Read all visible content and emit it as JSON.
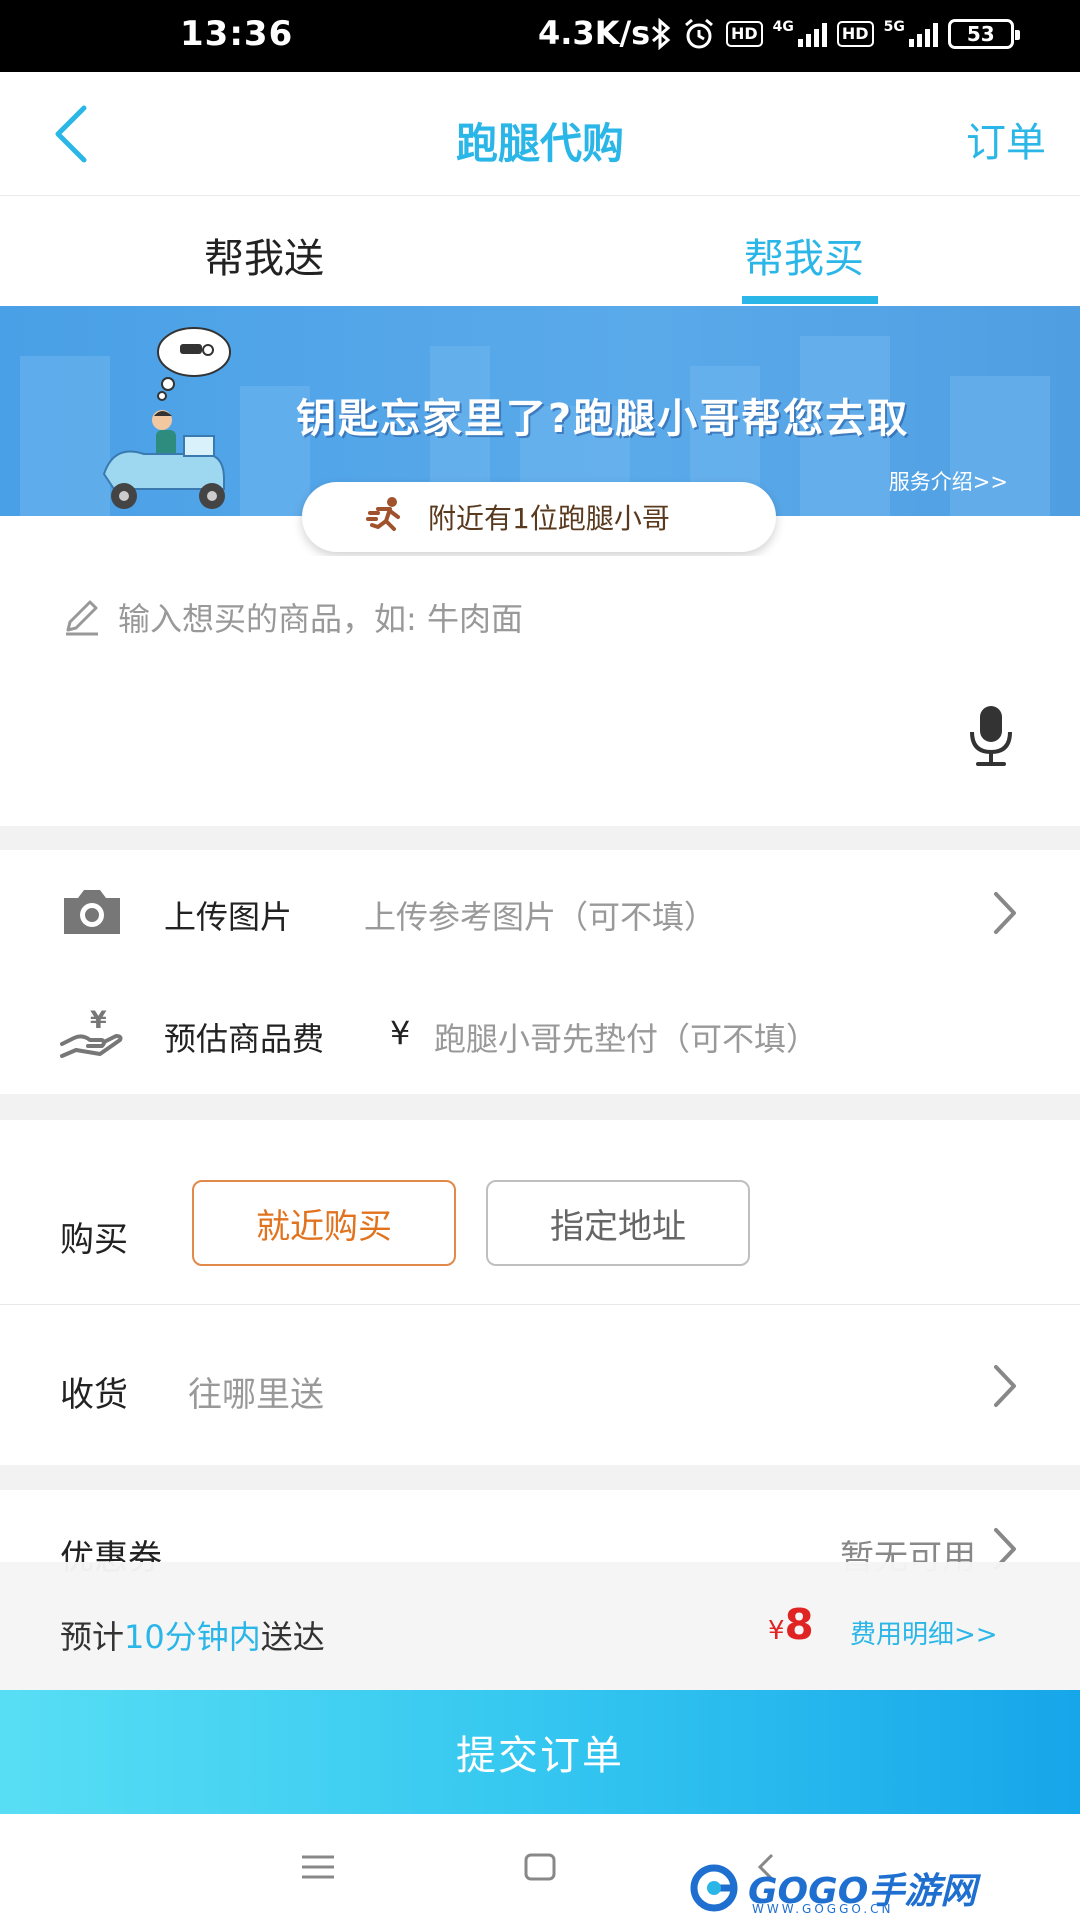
{
  "status_bar": {
    "time": "13:36",
    "net_speed": "4.3K/s",
    "hd1": "HD",
    "net1": "4G",
    "hd2": "HD",
    "net2": "5G",
    "battery": "53"
  },
  "header": {
    "title": "跑腿代购",
    "orders_label": "订单"
  },
  "tabs": [
    {
      "label": "帮我送",
      "active": false
    },
    {
      "label": "帮我买",
      "active": true
    }
  ],
  "banner": {
    "headline": "钥匙忘家里了?跑腿小哥帮您去取",
    "intro_link": "服务介绍>>",
    "nearby": "附近有1位跑腿小哥"
  },
  "goods_input": {
    "placeholder": "输入想买的商品，如: 牛肉面"
  },
  "upload": {
    "label": "上传图片",
    "hint": "上传参考图片（可不填）"
  },
  "estimate": {
    "label": "预估商品费",
    "currency": "¥",
    "hint": "跑腿小哥先垫付（可不填）"
  },
  "purchase": {
    "label": "购买",
    "options": [
      {
        "label": "就近购买",
        "selected": true
      },
      {
        "label": "指定地址",
        "selected": false
      }
    ]
  },
  "receive": {
    "label": "收货",
    "hint": "往哪里送"
  },
  "coupon": {
    "label": "优惠券",
    "value": "暂无可用"
  },
  "summary": {
    "eta_prefix": "预计",
    "eta_highlight": "10分钟内",
    "eta_suffix": "送达",
    "price_currency": "¥",
    "price": "8",
    "detail_link": "费用明细>>"
  },
  "submit_label": "提交订单",
  "watermark": {
    "name_latin": "GOGO",
    "name_cn": "手游网",
    "url": "WWW.GOGGO.CN"
  },
  "colors": {
    "accent": "#2bb6e8",
    "orange": "#e2731e",
    "price_red": "#e02424"
  }
}
